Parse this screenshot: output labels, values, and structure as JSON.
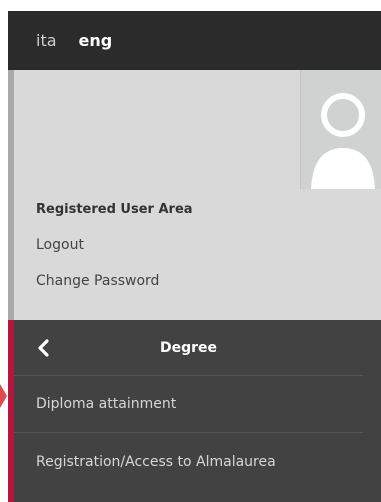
{
  "languages": {
    "ita": "ita",
    "eng": "eng",
    "active": "eng"
  },
  "user_area": {
    "title": "Registered User Area",
    "logout": "Logout",
    "change_password": "Change Password",
    "avatar_icon": "user-avatar-icon"
  },
  "menu": {
    "back_icon": "chevron-left-icon",
    "title": "Degree",
    "items": [
      {
        "label": "Diploma attainment"
      },
      {
        "label": "Registration/Access to Almalaurea"
      }
    ]
  },
  "colors": {
    "topbar": "#2b2b2b",
    "user_area_bg": "#d9d9d9",
    "menu_bg": "#424242",
    "accent": "#b5163d",
    "pointer_arrow": "#e04a4a"
  }
}
